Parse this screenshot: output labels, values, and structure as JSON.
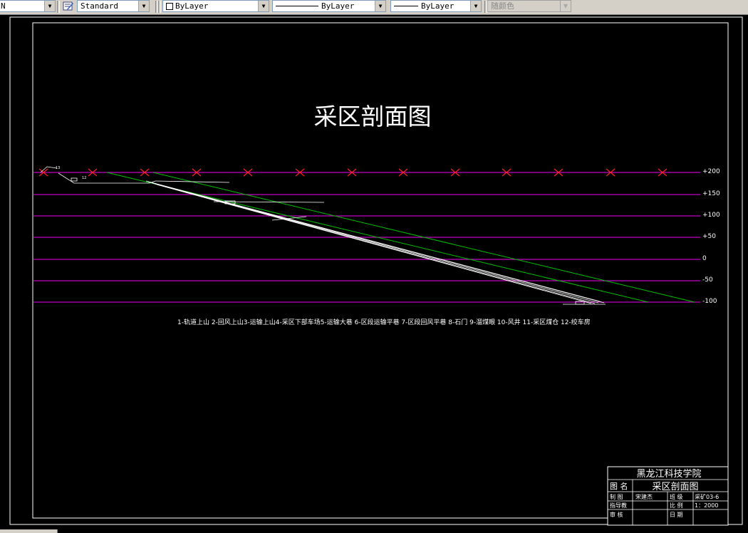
{
  "toolbar": {
    "textstyle": "Standard",
    "color": "ByLayer",
    "linetype": "ByLayer",
    "lineweight": "ByLayer",
    "plotstyle": "随颜色"
  },
  "drawing": {
    "title": "采区剖面图",
    "elevations": [
      "+200",
      "+150",
      "+100",
      "+50",
      "0",
      "-50",
      "-100"
    ],
    "legend": "1-轨道上山 2-回风上山3-运输上山4-采区下部车场5-运输大巷 6-区段运输平巷  7-区段回风平巷  8-石门  9-溜煤眼  10-风井     11-采区煤仓  12-绞车房",
    "labels": {
      "l13": "13",
      "l12": "12"
    }
  },
  "titleblock": {
    "school": "黑龙江科技学院",
    "name_label": "图 名",
    "name_value": "采区剖面图",
    "row1": {
      "label": "制  图",
      "value": "宋建杰",
      "label2": "班  级",
      "value2": "采矿03-6"
    },
    "row2": {
      "label": "指导教",
      "value": "",
      "label2": "比  例",
      "value2": "1：2000"
    },
    "row3": {
      "label": "审  核",
      "value": "",
      "label2": "日     期",
      "value2": ""
    }
  },
  "colors": {
    "magenta": "#c000c0",
    "green": "#00c000",
    "red": "#ff2020",
    "white": "#ffffff"
  }
}
